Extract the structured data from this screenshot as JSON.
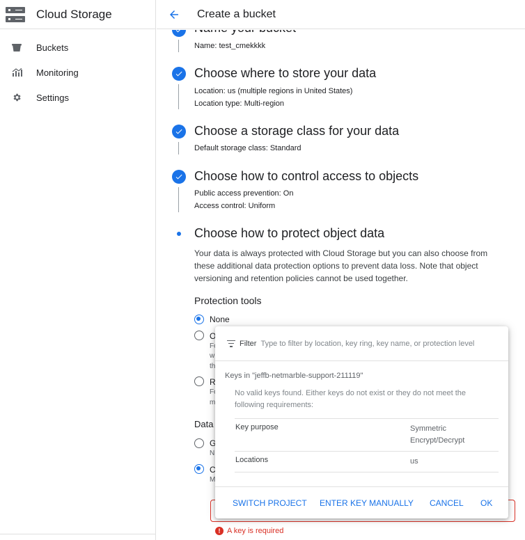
{
  "sidebar": {
    "product_title": "Cloud Storage",
    "items": [
      {
        "label": "Buckets",
        "icon": "bucket-icon"
      },
      {
        "label": "Monitoring",
        "icon": "chart-icon"
      },
      {
        "label": "Settings",
        "icon": "gear-icon"
      }
    ]
  },
  "header": {
    "title": "Create a bucket"
  },
  "steps": {
    "name": {
      "title": "Name your bucket",
      "fields": [
        {
          "key": "Name:",
          "value": "test_cmekkkk"
        }
      ]
    },
    "location": {
      "title": "Choose where to store your data",
      "fields": [
        {
          "key": "Location:",
          "value": "us (multiple regions in United States)"
        },
        {
          "key": "Location type:",
          "value": "Multi-region"
        }
      ]
    },
    "storage_class": {
      "title": "Choose a storage class for your data",
      "fields": [
        {
          "key": "Default storage class:",
          "value": "Standard"
        }
      ]
    },
    "access": {
      "title": "Choose how to control access to objects",
      "fields": [
        {
          "key": "Public access prevention:",
          "value": "On"
        },
        {
          "key": "Access control:",
          "value": "Uniform"
        }
      ]
    },
    "protect": {
      "title": "Choose how to protect object data",
      "description": "Your data is always protected with Cloud Storage but you can also choose from these additional data protection options to prevent data loss. Note that object versioning and retention policies cannot be used together.",
      "protection_tools_heading": "Protection tools",
      "protection_options": [
        {
          "label": "None",
          "selected": true
        },
        {
          "label": "O",
          "sub": [
            "Fo",
            "w",
            "th"
          ]
        },
        {
          "label": "R",
          "sub": [
            "Fo",
            "m"
          ]
        }
      ],
      "encryption_heading": "Data",
      "encryption_options": [
        {
          "label": "Go",
          "sub": "N"
        },
        {
          "label": "Cu",
          "sub": "M",
          "selected": true
        }
      ],
      "error": "A key is required"
    }
  },
  "key_popup": {
    "filter_label": "Filter",
    "filter_placeholder": "Type to filter by location, key ring, key name, or protection level",
    "keys_heading": "Keys in \"jeffb-netmarble-support-211119\"",
    "no_keys_message": "No valid keys found. Either keys do not exist or they do not meet the following requirements:",
    "requirements": [
      {
        "key": "Key purpose",
        "value": "Symmetric Encrypt/Decrypt"
      },
      {
        "key": "Locations",
        "value": "us"
      }
    ],
    "buttons": {
      "switch_project": "SWITCH PROJECT",
      "enter_key_manually": "ENTER KEY MANUALLY",
      "cancel": "CANCEL",
      "ok": "OK"
    }
  },
  "colors": {
    "accent": "#1a73e8",
    "error": "#d93025"
  }
}
